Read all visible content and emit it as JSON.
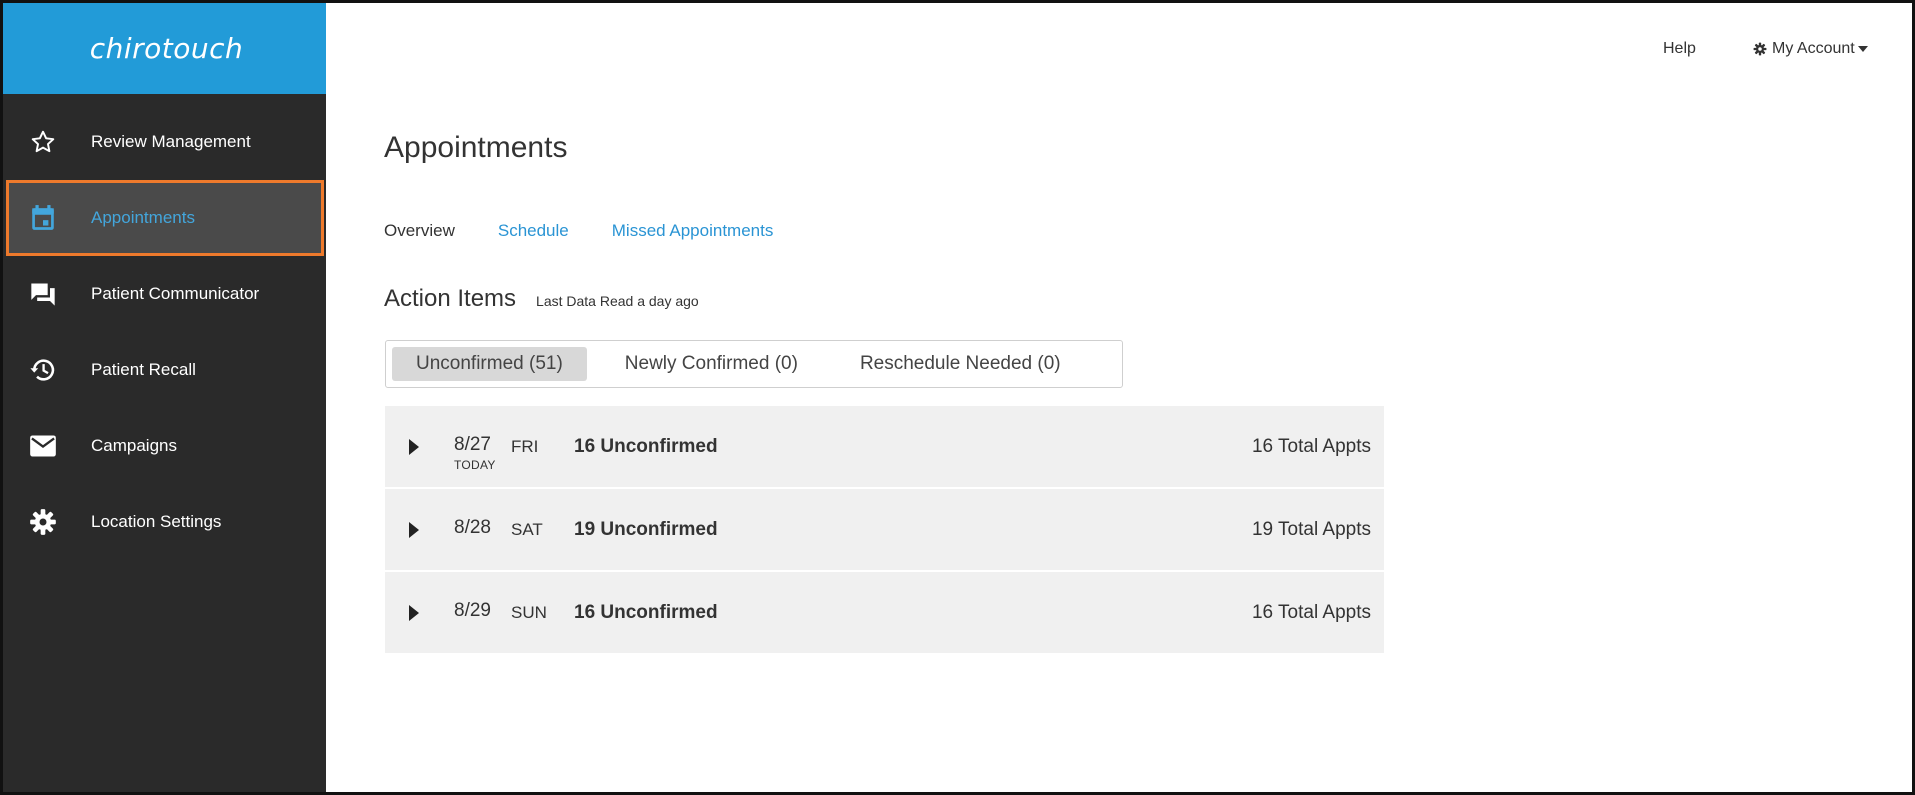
{
  "brand": {
    "logo_text": "chirotouch",
    "accent": "#229bd8",
    "sidebar_bg": "#2a2a2a",
    "highlight": "#ee7a2c"
  },
  "sidebar": {
    "items": [
      {
        "label": "Review Management",
        "icon": "star-icon"
      },
      {
        "label": "Appointments",
        "icon": "calendar-icon",
        "active": true
      },
      {
        "label": "Patient Communicator",
        "icon": "chat-icon"
      },
      {
        "label": "Patient Recall",
        "icon": "history-icon"
      },
      {
        "label": "Campaigns",
        "icon": "envelope-icon"
      },
      {
        "label": "Location Settings",
        "icon": "gear-icon"
      }
    ]
  },
  "topbar": {
    "help": "Help",
    "account": "My Account"
  },
  "main": {
    "title": "Appointments",
    "tabs": [
      {
        "label": "Overview",
        "current": true
      },
      {
        "label": "Schedule"
      },
      {
        "label": "Missed Appointments"
      }
    ],
    "action_items": {
      "title": "Action Items",
      "meta": "Last Data Read a day ago"
    },
    "segments": [
      {
        "label": "Unconfirmed (51)",
        "active": true
      },
      {
        "label": "Newly Confirmed (0)"
      },
      {
        "label": "Reschedule Needed (0)"
      }
    ],
    "rows": [
      {
        "date": "8/27",
        "today": "TODAY",
        "dow": "FRI",
        "unconfirmed": "16 Unconfirmed",
        "total": "16 Total Appts"
      },
      {
        "date": "8/28",
        "today": "",
        "dow": "SAT",
        "unconfirmed": "19 Unconfirmed",
        "total": "19 Total Appts"
      },
      {
        "date": "8/29",
        "today": "",
        "dow": "SUN",
        "unconfirmed": "16 Unconfirmed",
        "total": "16 Total Appts"
      }
    ]
  }
}
